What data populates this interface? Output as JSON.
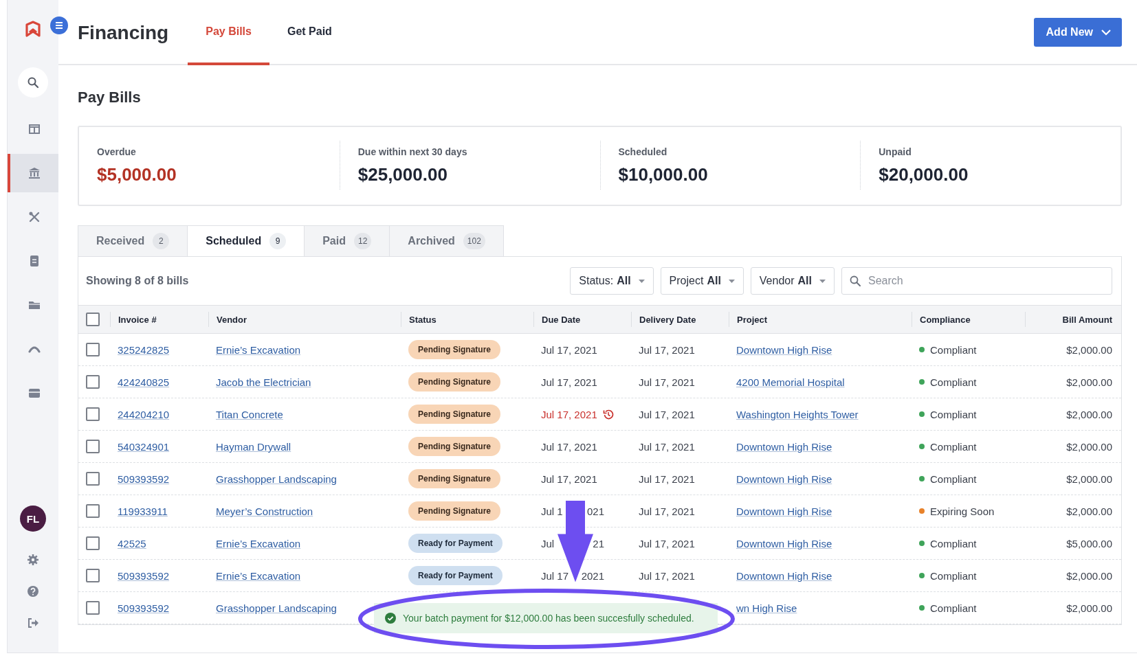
{
  "app": {
    "title": "Financing",
    "nav_tabs": [
      {
        "label": "Pay Bills",
        "selected": true
      },
      {
        "label": "Get Paid",
        "selected": false
      }
    ],
    "add_button": "Add New"
  },
  "sidebar": {
    "items": [
      {
        "kind": "search",
        "selected": false
      },
      {
        "kind": "columns",
        "selected": false
      },
      {
        "kind": "bank",
        "selected": true
      },
      {
        "kind": "tools",
        "selected": false
      },
      {
        "kind": "document",
        "selected": false
      },
      {
        "kind": "folder",
        "selected": false
      },
      {
        "kind": "arch",
        "selected": false
      },
      {
        "kind": "tray",
        "selected": false
      }
    ],
    "avatar": "FL",
    "footer": [
      {
        "kind": "settings"
      },
      {
        "kind": "help"
      },
      {
        "kind": "logout"
      }
    ]
  },
  "page_title": "Pay Bills",
  "summary": [
    {
      "label": "Overdue",
      "amount": "$5,000.00",
      "kind": "alert"
    },
    {
      "label": "Due within next 30 days",
      "amount": "$25,000.00",
      "kind": "normal"
    },
    {
      "label": "Scheduled",
      "amount": "$10,000.00",
      "kind": "normal"
    },
    {
      "label": "Unpaid",
      "amount": "$20,000.00",
      "kind": "normal"
    }
  ],
  "tabs": [
    {
      "label": "Received",
      "count": "2",
      "selected": false
    },
    {
      "label": "Scheduled",
      "count": "9",
      "selected": true
    },
    {
      "label": "Paid",
      "count": "12",
      "selected": false
    },
    {
      "label": "Archived",
      "count": "102",
      "selected": false
    }
  ],
  "toolbar": {
    "showing": "Showing 8 of 8 bills",
    "filters": [
      {
        "label": "Status:",
        "value": "All"
      },
      {
        "label": "Project",
        "value": "All"
      },
      {
        "label": "Vendor",
        "value": "All"
      }
    ],
    "search": {
      "placeholder": "Search"
    }
  },
  "table": {
    "all_checked": false,
    "columns": [
      "Invoice #",
      "Vendor",
      "Status",
      "Due Date",
      "Delivery Date",
      "Project",
      "Compliance",
      "Bill Amount"
    ],
    "rows": [
      {
        "checked": false,
        "invoice": "325242825",
        "vendor": "Ernie’s Excavation",
        "status": {
          "label": "Pending Signature",
          "kind": "pending"
        },
        "due_date": [
          "Jul 17, 2021"
        ],
        "overdue": false,
        "delivery_date": "Jul 17, 2021",
        "project": "Downtown High Rise",
        "compliance": {
          "label": "Compliant",
          "color": "#3fa45a"
        },
        "amount": "$2,000.00"
      },
      {
        "checked": false,
        "invoice": "424240825",
        "vendor": "Jacob the Electrician",
        "status": {
          "label": "Pending Signature",
          "kind": "pending"
        },
        "due_date": [
          "Jul 17, 2021"
        ],
        "overdue": false,
        "delivery_date": "Jul 17, 2021",
        "project": "4200 Memorial Hospital",
        "compliance": {
          "label": "Compliant",
          "color": "#3fa45a"
        },
        "amount": "$2,000.00"
      },
      {
        "checked": false,
        "invoice": "244204210",
        "vendor": "Titan Concrete",
        "status": {
          "label": "Pending Signature",
          "kind": "pending"
        },
        "due_date": [
          "Jul 17, 2021"
        ],
        "overdue": true,
        "delivery_date": "Jul 17, 2021",
        "project": "Washington Heights Tower",
        "compliance": {
          "label": "Compliant",
          "color": "#3fa45a"
        },
        "amount": "$2,000.00"
      },
      {
        "checked": false,
        "invoice": "540324901",
        "vendor": "Hayman Drywall",
        "status": {
          "label": "Pending Signature",
          "kind": "pending"
        },
        "due_date": [
          "Jul 17, 2021"
        ],
        "overdue": false,
        "delivery_date": "Jul 17, 2021",
        "project": "Downtown High Rise",
        "compliance": {
          "label": "Compliant",
          "color": "#3fa45a"
        },
        "amount": "$2,000.00"
      },
      {
        "checked": false,
        "invoice": "509393592",
        "vendor": "Grasshopper Landscaping",
        "status": {
          "label": "Pending Signature",
          "kind": "pending"
        },
        "due_date": [
          "Jul 17, 2021"
        ],
        "overdue": false,
        "delivery_date": "Jul 17, 2021",
        "project": "Downtown High Rise",
        "compliance": {
          "label": "Compliant",
          "color": "#3fa45a"
        },
        "amount": "$2,000.00"
      },
      {
        "checked": false,
        "invoice": "119933911",
        "vendor": "Meyer’s Construction",
        "status": {
          "label": "Pending Signature",
          "kind": "pending"
        },
        "due_date": [
          "Jul 1",
          "021"
        ],
        "overdue": false,
        "delivery_date": "Jul 17, 2021",
        "project": "Downtown High Rise",
        "compliance": {
          "label": "Expiring Soon",
          "color": "#e8822a"
        },
        "amount": "$2,000.00"
      },
      {
        "checked": false,
        "invoice": "42525",
        "vendor": "Ernie’s Excavation",
        "status": {
          "label": "Ready for Payment",
          "kind": "ready"
        },
        "due_date": [
          "Jul",
          "21"
        ],
        "overdue": false,
        "delivery_date": "Jul 17, 2021",
        "project": "Downtown High Rise",
        "compliance": {
          "label": "Compliant",
          "color": "#3fa45a"
        },
        "amount": "$5,000.00"
      },
      {
        "checked": false,
        "invoice": "509393592",
        "vendor": "Ernie’s Excavation",
        "status": {
          "label": "Ready for Payment",
          "kind": "ready"
        },
        "due_date": [
          "Jul 17",
          "2021"
        ],
        "overdue": false,
        "delivery_date": "Jul 17, 2021",
        "project": "Downtown High Rise",
        "compliance": {
          "label": "Compliant",
          "color": "#3fa45a"
        },
        "amount": "$2,000.00"
      },
      {
        "checked": false,
        "invoice": "509393592",
        "vendor": "Grasshopper Landscaping",
        "project": "wn High Rise",
        "compliance": {
          "label": "Compliant",
          "color": "#3fa45a"
        },
        "amount": "$2,000.00"
      }
    ]
  },
  "toast": {
    "message": "Your batch payment for $12,000.00 has been succesfully scheduled."
  }
}
